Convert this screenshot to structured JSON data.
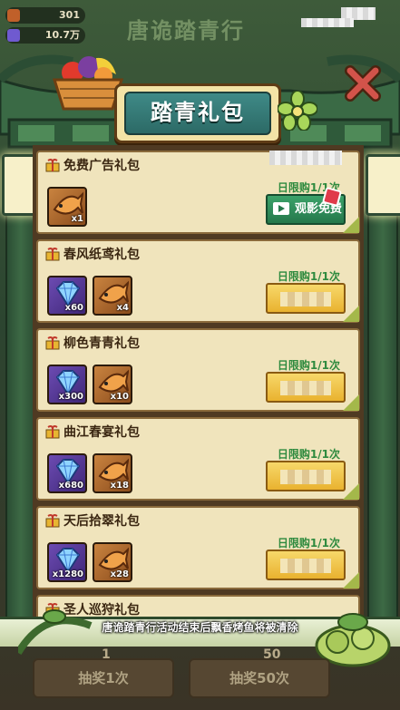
{
  "background": {
    "res1": "301",
    "res2": "10.7万",
    "title": "唐诡踏青行",
    "draw1_count": "1",
    "draw50_count": "50",
    "draw1_label": "抽奖1次",
    "draw50_label": "抽奖50次"
  },
  "header": {
    "title": "踏青礼包",
    "close_icon": "close-x-icon"
  },
  "packs": [
    {
      "name": "免费广告礼包",
      "limit": "日限购1/1次",
      "button": "watch-ad",
      "button_label": "观影免费",
      "items": [
        {
          "type": "fish",
          "count": "x1"
        }
      ]
    },
    {
      "name": "春风纸鸢礼包",
      "limit": "日限购1/1次",
      "button": "price",
      "items": [
        {
          "type": "gem",
          "count": "x60"
        },
        {
          "type": "fish",
          "count": "x4"
        }
      ]
    },
    {
      "name": "柳色青青礼包",
      "limit": "日限购1/1次",
      "button": "price",
      "items": [
        {
          "type": "gem",
          "count": "x300"
        },
        {
          "type": "fish",
          "count": "x10"
        }
      ]
    },
    {
      "name": "曲江春宴礼包",
      "limit": "日限购1/1次",
      "button": "price",
      "items": [
        {
          "type": "gem",
          "count": "x680"
        },
        {
          "type": "fish",
          "count": "x18"
        }
      ]
    },
    {
      "name": "天后拾翠礼包",
      "limit": "日限购1/1次",
      "button": "price",
      "items": [
        {
          "type": "gem",
          "count": "x1280"
        },
        {
          "type": "fish",
          "count": "x28"
        }
      ]
    },
    {
      "name": "圣人巡狩礼包",
      "limit": "",
      "button": "price",
      "items": []
    }
  ],
  "footer": {
    "notice": "唐诡踏青行活动结束后飘香烤鱼将被清除"
  },
  "colors": {
    "accent_green": "#2e8a3e",
    "card_bg": "#f0e4bc",
    "frame_green": "#3d6a45"
  }
}
